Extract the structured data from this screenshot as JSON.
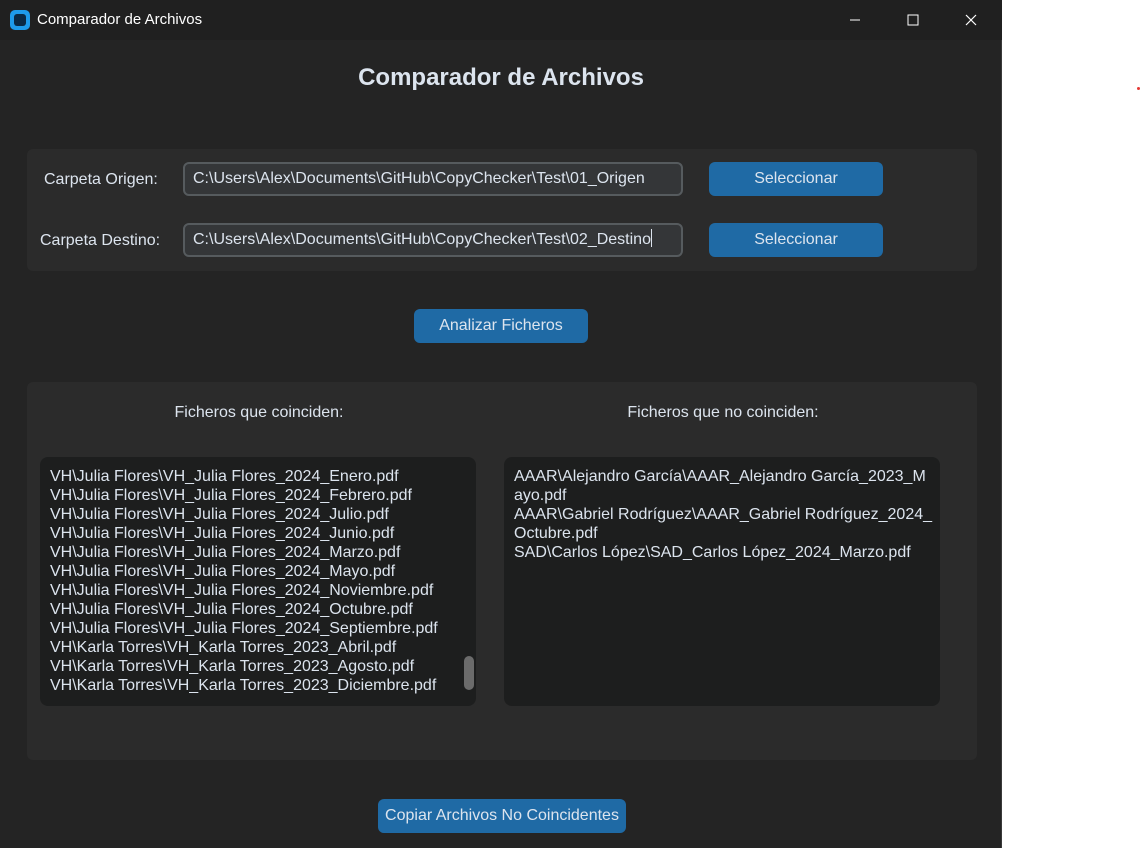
{
  "window": {
    "title": "Comparador de Archivos",
    "controls": {
      "minimize": "minimize",
      "maximize": "maximize",
      "close": "close"
    }
  },
  "heading": "Comparador de Archivos",
  "folders": {
    "origin": {
      "label": "Carpeta Origen:",
      "value": "C:\\Users\\Alex\\Documents\\GitHub\\CopyChecker\\Test\\01_Origen",
      "button_label": "Seleccionar"
    },
    "destination": {
      "label": "Carpeta Destino:",
      "value": "C:\\Users\\Alex\\Documents\\GitHub\\CopyChecker\\Test\\02_Destino",
      "button_label": "Seleccionar"
    }
  },
  "analyze_button": "Analizar Ficheros",
  "matching": {
    "label": "Ficheros que coinciden:",
    "items": [
      "VH\\Julia Flores\\VH_Julia Flores_2024_Enero.pdf",
      "VH\\Julia Flores\\VH_Julia Flores_2024_Febrero.pdf",
      "VH\\Julia Flores\\VH_Julia Flores_2024_Julio.pdf",
      "VH\\Julia Flores\\VH_Julia Flores_2024_Junio.pdf",
      "VH\\Julia Flores\\VH_Julia Flores_2024_Marzo.pdf",
      "VH\\Julia Flores\\VH_Julia Flores_2024_Mayo.pdf",
      "VH\\Julia Flores\\VH_Julia Flores_2024_Noviembre.pdf",
      "VH\\Julia Flores\\VH_Julia Flores_2024_Octubre.pdf",
      "VH\\Julia Flores\\VH_Julia Flores_2024_Septiembre.pdf",
      "VH\\Karla Torres\\VH_Karla Torres_2023_Abril.pdf",
      "VH\\Karla Torres\\VH_Karla Torres_2023_Agosto.pdf",
      "VH\\Karla Torres\\VH_Karla Torres_2023_Diciembre.pdf"
    ]
  },
  "non_matching": {
    "label": "Ficheros que no coinciden:",
    "items": [
      "AAAR\\Alejandro García\\AAAR_Alejandro García_2023_Mayo.pdf",
      "AAAR\\Gabriel Rodríguez\\AAAR_Gabriel Rodríguez_2024_Octubre.pdf",
      "SAD\\Carlos López\\SAD_Carlos López_2024_Marzo.pdf"
    ]
  },
  "copy_button": "Copiar Archivos No Coincidentes",
  "colors": {
    "accent": "#1f6aa5",
    "window_bg": "#242424",
    "panel_bg": "#2b2b2b",
    "list_bg": "#1d1e1e",
    "text": "#dce4ee"
  }
}
